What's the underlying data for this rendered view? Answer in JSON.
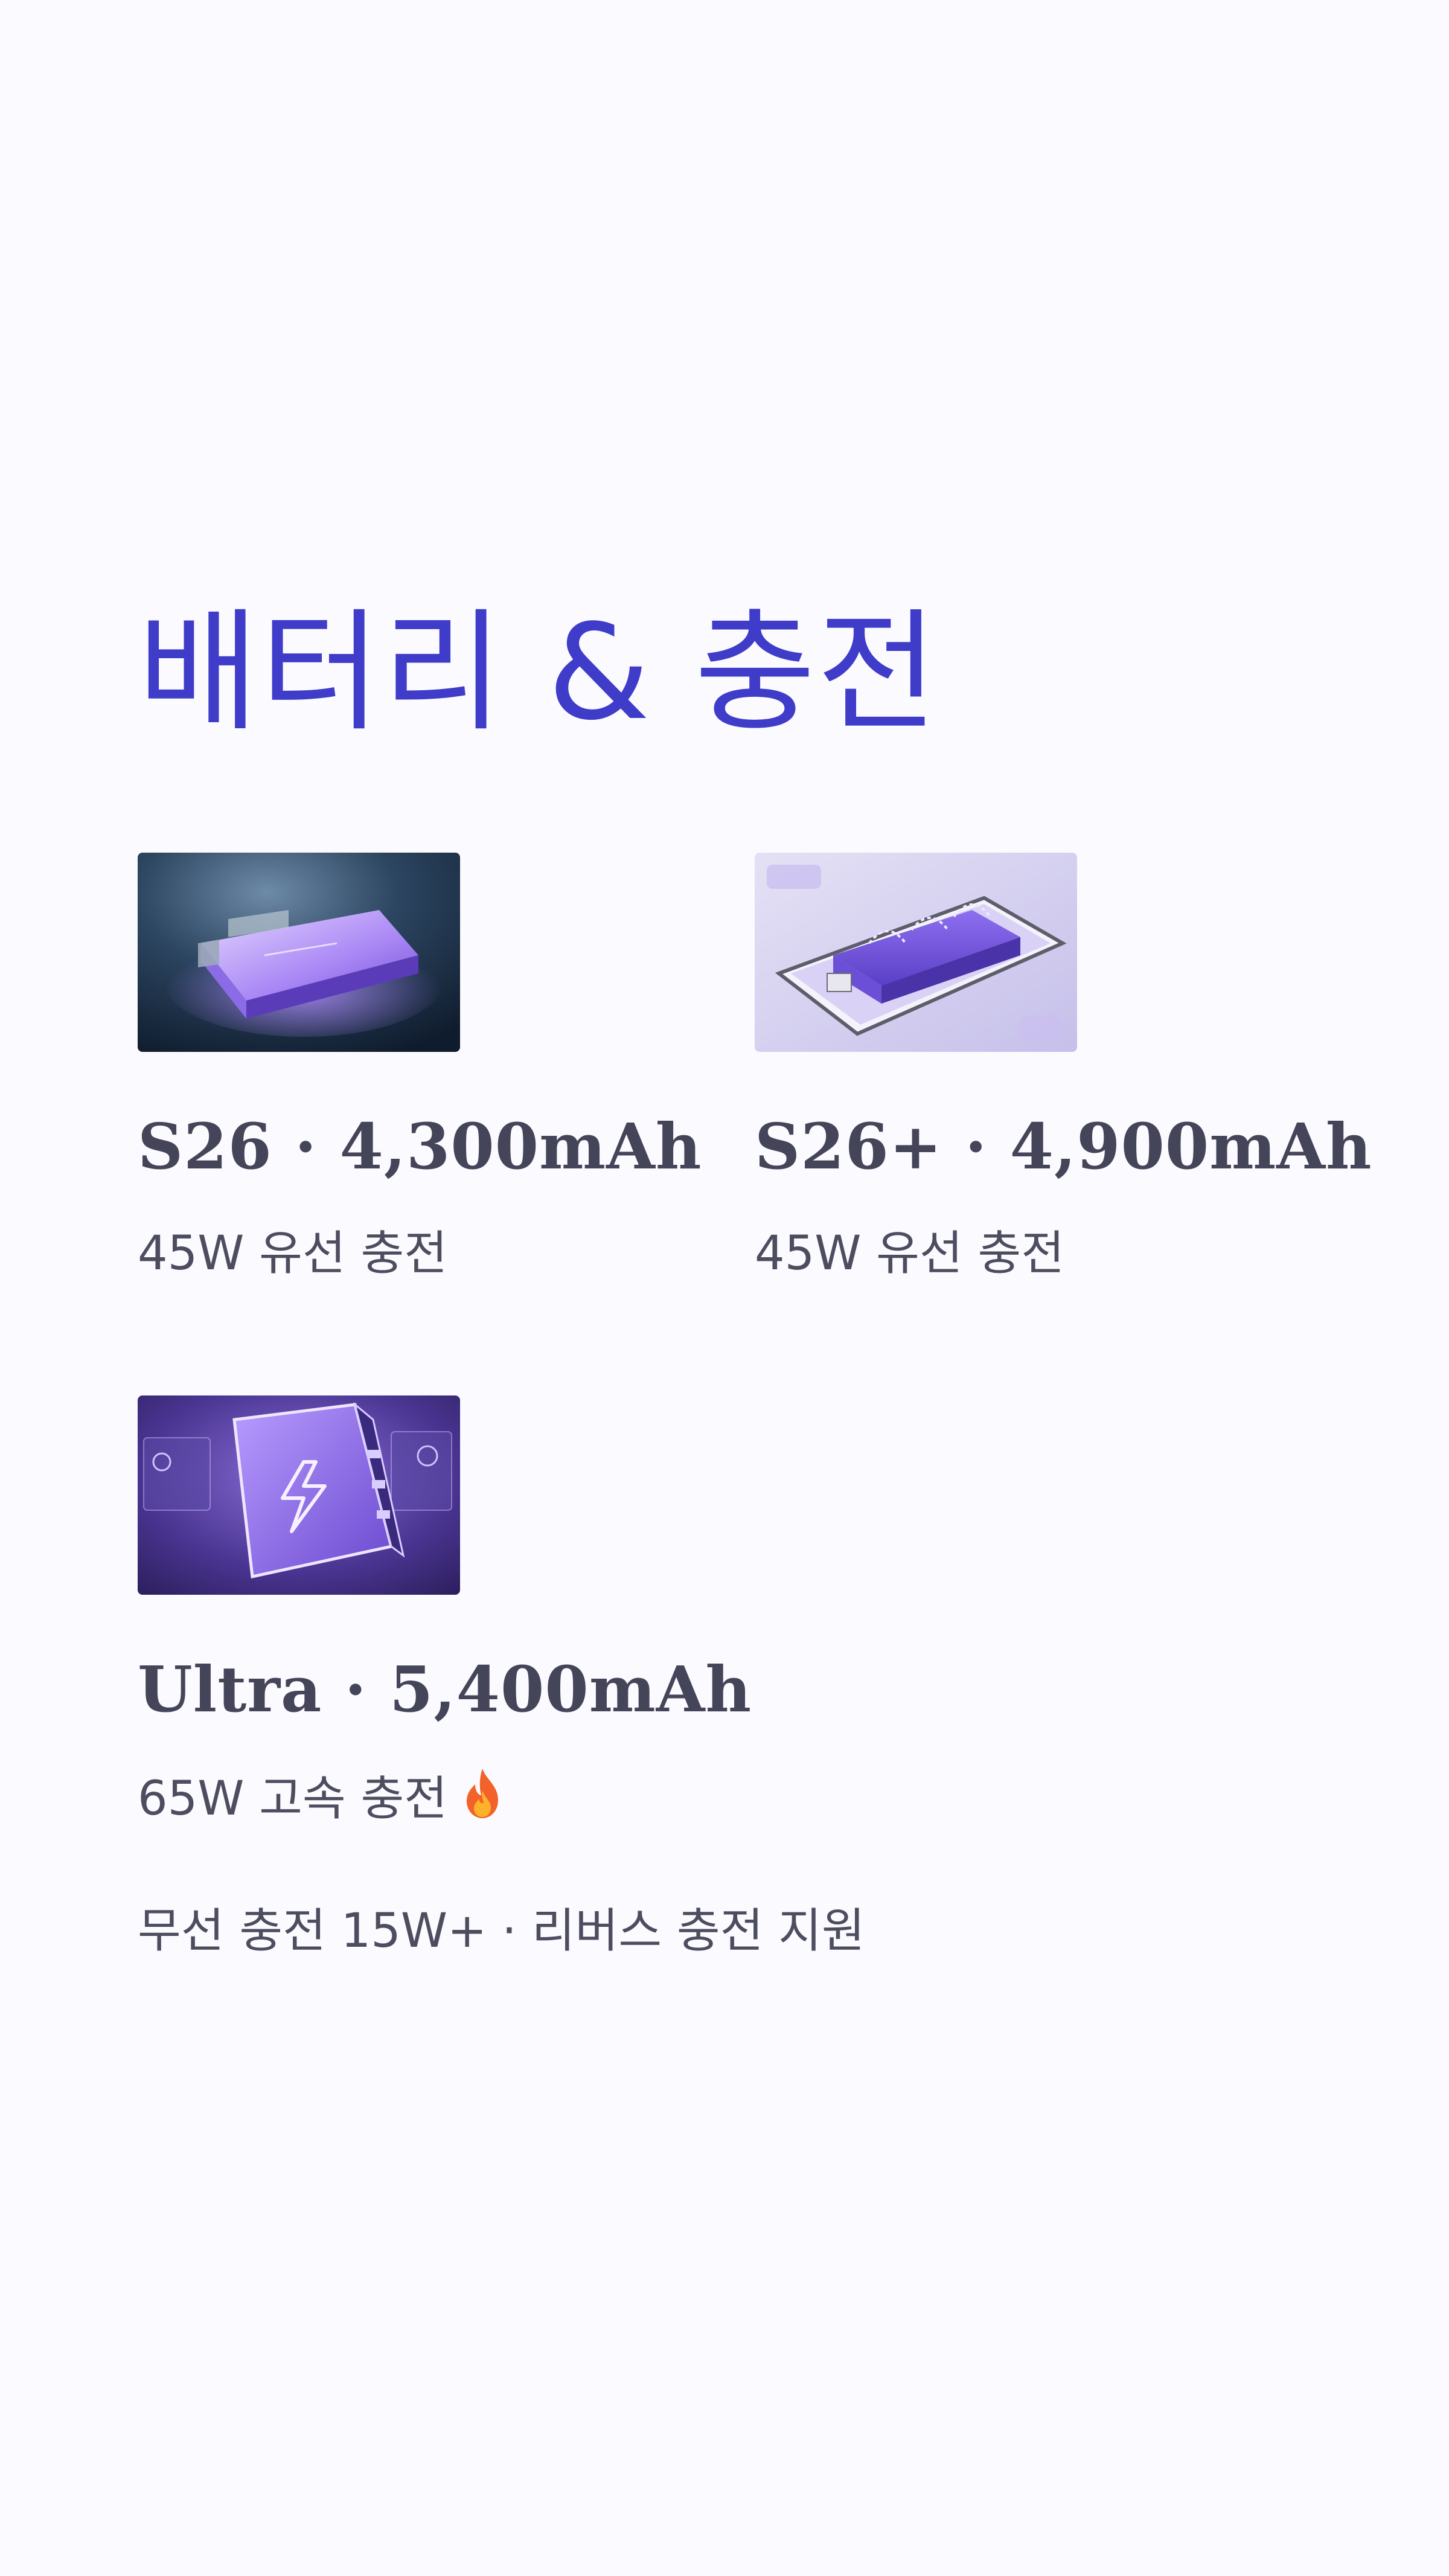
{
  "heading": "배터리 & 충전",
  "colors": {
    "background": "#fbfaff",
    "heading": "#3f3cc9",
    "text": "#4d4d60",
    "accent_purple": "#8e6ff0"
  },
  "models": [
    {
      "name": "S26 · 4,300mAh",
      "charging": "45W 유선 충전",
      "image_icon": "glowing-battery-cell-image"
    },
    {
      "name": "S26+ · 4,900mAh",
      "charging": "45W 유선 충전",
      "image_icon": "phone-battery-cutaway-image"
    },
    {
      "name": "Ultra · 5,400mAh",
      "charging": "65W 고속 충전",
      "charging_icon": "fire-icon",
      "image_icon": "lightning-battery-image"
    }
  ],
  "footnote": "무선 충전 15W+ · 리버스 충전 지원"
}
